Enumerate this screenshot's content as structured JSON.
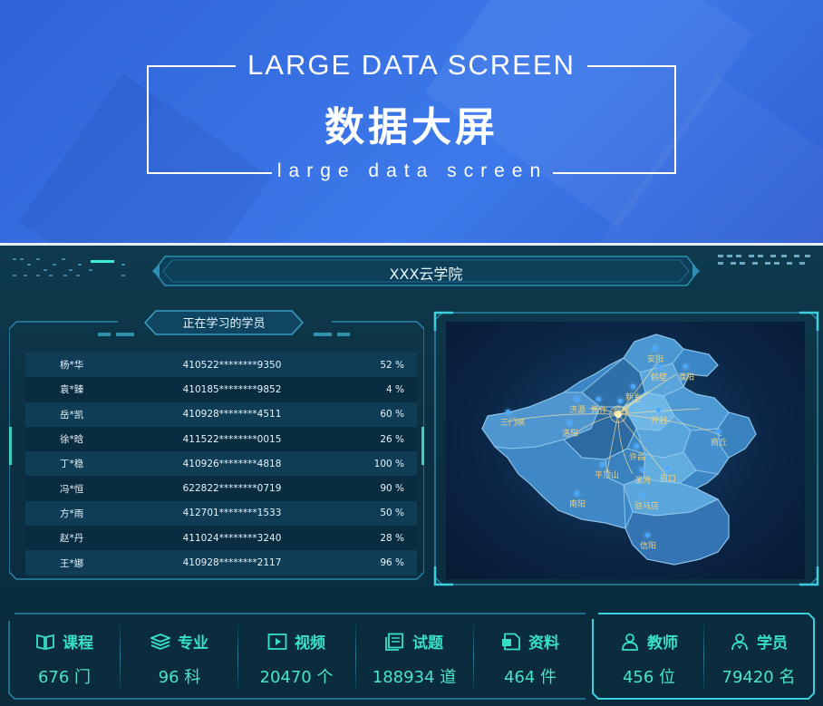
{
  "banner": {
    "title_en": "LARGE DATA SCREEN",
    "title_cn": "数据大屏",
    "subtitle": "large data screen"
  },
  "dashboard": {
    "title": "XXX云学院",
    "students_panel": {
      "title": "正在学习的学员",
      "rows": [
        {
          "name": "杨*华",
          "id": "410522********9350",
          "progress": "52 %"
        },
        {
          "name": "袁*臻",
          "id": "410185********9852",
          "progress": "4 %"
        },
        {
          "name": "岳*凯",
          "id": "410928********4511",
          "progress": "60 %"
        },
        {
          "name": "徐*晗",
          "id": "411522********0015",
          "progress": "26 %"
        },
        {
          "name": "丁*稳",
          "id": "410926********4818",
          "progress": "100 %"
        },
        {
          "name": "冯*恒",
          "id": "622822********0719",
          "progress": "90 %"
        },
        {
          "name": "方*雨",
          "id": "412701********1533",
          "progress": "50 %"
        },
        {
          "name": "赵*丹",
          "id": "411024********3240",
          "progress": "28 %"
        },
        {
          "name": "王*娜",
          "id": "410928********2117",
          "progress": "96 %"
        }
      ]
    },
    "map": {
      "cities": [
        "安阳",
        "鹤壁",
        "濮阳",
        "新乡",
        "焦作",
        "济源",
        "三门峡",
        "洛阳",
        "郑州",
        "开封",
        "商丘",
        "平顶山",
        "许昌",
        "漯河",
        "周口",
        "南阳",
        "驻马店",
        "信阳"
      ]
    },
    "stats": [
      {
        "icon": "book-icon",
        "label": "课程",
        "value": "676 门"
      },
      {
        "icon": "layers-icon",
        "label": "专业",
        "value": "96 科"
      },
      {
        "icon": "video-icon",
        "label": "视频",
        "value": "20470 个"
      },
      {
        "icon": "quiz-icon",
        "label": "试题",
        "value": "188934 道"
      },
      {
        "icon": "document-icon",
        "label": "资料",
        "value": "464 件"
      },
      {
        "icon": "teacher-icon",
        "label": "教师",
        "value": "456 位"
      },
      {
        "icon": "student-icon",
        "label": "学员",
        "value": "79420 名"
      }
    ]
  },
  "colors": {
    "banner_blue": "#3a74e6",
    "dashboard_bg": "#0b3042",
    "accent_teal": "#38e0c6",
    "city_label": "#f2d27a"
  }
}
